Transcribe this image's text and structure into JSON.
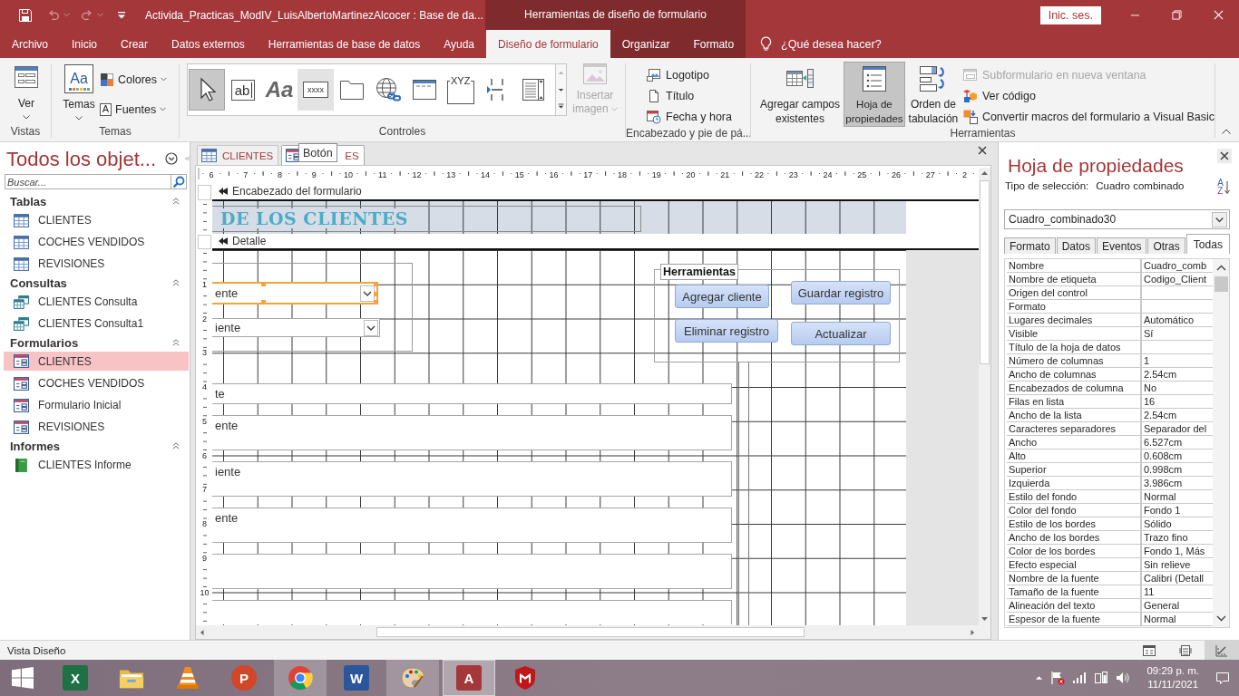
{
  "title_bar": {
    "title": "Activida_Practicas_ModIV_LuisAlbertoMartinezAlcocer : Base de da...",
    "context_title": "Herramientas de diseño de formulario",
    "sign_in": "Inic. ses."
  },
  "ribbon_tabs": [
    {
      "label": "Archivo",
      "selected": false,
      "contextual": false
    },
    {
      "label": "Inicio",
      "selected": false,
      "contextual": false
    },
    {
      "label": "Crear",
      "selected": false,
      "contextual": false
    },
    {
      "label": "Datos externos",
      "selected": false,
      "contextual": false
    },
    {
      "label": "Herramientas de base de datos",
      "selected": false,
      "contextual": false
    },
    {
      "label": "Ayuda",
      "selected": false,
      "contextual": false
    },
    {
      "label": "Diseño de formulario",
      "selected": true,
      "contextual": true
    },
    {
      "label": "Organizar",
      "selected": false,
      "contextual": true
    },
    {
      "label": "Formato",
      "selected": false,
      "contextual": true
    }
  ],
  "tell_me": "¿Qué desea hacer?",
  "ribbon": {
    "views": {
      "label": "Vistas",
      "view_button": "Ver"
    },
    "themes": {
      "label": "Temas",
      "themes_button": "Temas",
      "themes_glyph": "Aa",
      "colors_button": "Colores",
      "fonts_button": "Fuentes",
      "fonts_glyph": "A"
    },
    "controls": {
      "label": "Controles",
      "gallery": [
        {
          "selected": true,
          "hovered": false
        },
        {
          "glyph": "ab",
          "selected": false,
          "hovered": false
        },
        {
          "glyph": "Aa",
          "selected": false,
          "hovered": false
        },
        {
          "glyph": "xxxx",
          "selected": false,
          "hovered": true
        },
        {
          "selected": false,
          "hovered": false
        },
        {
          "selected": false,
          "hovered": false
        },
        {
          "selected": false,
          "hovered": false
        },
        {
          "glyph": "XYZ",
          "selected": false,
          "hovered": false
        },
        {
          "selected": false,
          "hovered": false
        },
        {
          "selected": false,
          "hovered": false
        }
      ],
      "insert_image": {
        "label": "Insertar imagen",
        "disabled": true
      }
    },
    "header_footer": {
      "label": "Encabezado y pie de pá...",
      "items": [
        "Logotipo",
        "Título",
        "Fecha y hora"
      ]
    },
    "tools": {
      "label": "Herramientas",
      "large": [
        {
          "label": "Agregar campos existentes",
          "selected": false
        },
        {
          "label": "Hoja de propiedades",
          "selected": true
        },
        {
          "label": "Orden de tabulación",
          "selected": false
        }
      ],
      "small": [
        {
          "label": "Subformulario en nueva ventana",
          "disabled": true
        },
        {
          "label": "Ver código",
          "disabled": false
        },
        {
          "label": "Convertir macros del formulario a Visual Basic",
          "disabled": false
        }
      ]
    }
  },
  "nav_pane": {
    "title": "Todos los objet...",
    "search_placeholder": "Buscar...",
    "groups": [
      {
        "label": "Tablas",
        "expanded": true,
        "items": [
          {
            "label": "CLIENTES",
            "kind": "table",
            "selected": false
          },
          {
            "label": "COCHES VENDIDOS",
            "kind": "table",
            "selected": false
          },
          {
            "label": "REVISIONES",
            "kind": "table",
            "selected": false
          }
        ]
      },
      {
        "label": "Consultas",
        "expanded": true,
        "items": [
          {
            "label": "CLIENTES Consulta",
            "kind": "query",
            "selected": false
          },
          {
            "label": "CLIENTES Consulta1",
            "kind": "query",
            "selected": false
          }
        ]
      },
      {
        "label": "Formularios",
        "expanded": true,
        "items": [
          {
            "label": "CLIENTES",
            "kind": "form",
            "selected": true
          },
          {
            "label": "COCHES VENDIDOS",
            "kind": "form",
            "selected": false
          },
          {
            "label": "Formulario Inicial",
            "kind": "form",
            "selected": false
          },
          {
            "label": "REVISIONES",
            "kind": "form",
            "selected": false
          }
        ]
      },
      {
        "label": "Informes",
        "expanded": true,
        "items": [
          {
            "label": "CLIENTES Informe",
            "kind": "report",
            "selected": false
          }
        ]
      }
    ]
  },
  "document": {
    "tabs": [
      {
        "label": "CLIENTES",
        "kind": "table",
        "selected": false
      },
      {
        "label": "ES",
        "kind": "form",
        "selected": true
      }
    ],
    "tooltip": "Botón",
    "ruler": {
      "horizontal": [
        "6",
        "7",
        "8",
        "9",
        "10",
        "11",
        "12",
        "13",
        "14",
        "15",
        "16",
        "17",
        "18",
        "19",
        "20",
        "21",
        "22",
        "23",
        "24",
        "25",
        "26",
        "27",
        "2"
      ],
      "vertical": [
        "1",
        "2",
        "3",
        "4",
        "5",
        "6",
        "7",
        "8",
        "9",
        "10"
      ]
    },
    "header_section": {
      "label": "Encabezado del formulario",
      "title_label": "DE LOS CLIENTES"
    },
    "detail_section": {
      "label": "Detalle",
      "combo_boxes": [
        {
          "value": "ente",
          "selected": true
        },
        {
          "value": "iente",
          "selected": false
        }
      ],
      "option_group": {
        "label": "Herramientas",
        "buttons": [
          "Agregar cliente",
          "Guardar registro",
          "Eliminar registro",
          "Actualizar"
        ]
      },
      "text_boxes": [
        "te",
        "ente",
        "iente",
        "ente"
      ]
    }
  },
  "property_sheet": {
    "title": "Hoja de propiedades",
    "selection_type_label": "Tipo de selección:",
    "selection_type": "Cuadro combinado",
    "sort_letters": [
      "A",
      "Z"
    ],
    "object": "Cuadro_combinado30",
    "tabs": [
      {
        "label": "Formato",
        "selected": false
      },
      {
        "label": "Datos",
        "selected": false
      },
      {
        "label": "Eventos",
        "selected": false
      },
      {
        "label": "Otras",
        "selected": false
      },
      {
        "label": "Todas",
        "selected": true
      }
    ],
    "rows": [
      {
        "name": "Nombre",
        "value": "Cuadro_comb"
      },
      {
        "name": "Nombre de etiqueta",
        "value": "Codigo_Client"
      },
      {
        "name": "Origen del control"
      },
      {
        "name": "Formato"
      },
      {
        "name": "Lugares decimales",
        "value": "Automático"
      },
      {
        "name": "Visible",
        "value": "Sí"
      },
      {
        "name": "Título de la hoja de datos"
      },
      {
        "name": "Número de columnas",
        "value": "1"
      },
      {
        "name": "Ancho de columnas",
        "value": "2.54cm"
      },
      {
        "name": "Encabezados de columna",
        "value": "No"
      },
      {
        "name": "Filas en lista",
        "value": "16"
      },
      {
        "name": "Ancho de la lista",
        "value": "2.54cm"
      },
      {
        "name": "Caracteres separadores",
        "value": "Separador del"
      },
      {
        "name": "Ancho",
        "value": "6.527cm"
      },
      {
        "name": "Alto",
        "value": "0.608cm"
      },
      {
        "name": "Superior",
        "value": "0.998cm"
      },
      {
        "name": "Izquierda",
        "value": "3.986cm"
      },
      {
        "name": "Estilo del fondo",
        "value": "Normal"
      },
      {
        "name": "Color del fondo",
        "value": "Fondo 1"
      },
      {
        "name": "Estilo de los bordes",
        "value": "Sólido"
      },
      {
        "name": "Ancho de los bordes",
        "value": "Trazo fino"
      },
      {
        "name": "Color de los bordes",
        "value": "Fondo 1, Más"
      },
      {
        "name": "Efecto especial",
        "value": "Sin relieve"
      },
      {
        "name": "Nombre de la fuente",
        "value": "Calibri (Detall"
      },
      {
        "name": "Tamaño de la fuente",
        "value": "11"
      },
      {
        "name": "Alineación del texto",
        "value": "General"
      },
      {
        "name": "Espesor de la fuente",
        "value": "Normal"
      }
    ]
  },
  "status_bar": {
    "text": "Vista Diseño",
    "views": [
      {
        "selected": false
      },
      {
        "selected": false
      },
      {
        "selected": true
      }
    ]
  },
  "taskbar": {
    "apps": [
      {
        "glyph": "X",
        "running": false,
        "active": false
      },
      {
        "running": false,
        "active": false
      },
      {
        "running": false,
        "active": false
      },
      {
        "glyph": "P",
        "running": false,
        "active": false
      },
      {
        "running": true,
        "active": false
      },
      {
        "glyph": "W",
        "running": false,
        "active": false
      },
      {
        "running": true,
        "active": false
      },
      {
        "glyph": "A",
        "running": true,
        "active": true
      },
      {
        "running": false,
        "active": false
      }
    ],
    "clock": {
      "time": "09:29 p. m.",
      "date": "11/11/2021"
    }
  }
}
